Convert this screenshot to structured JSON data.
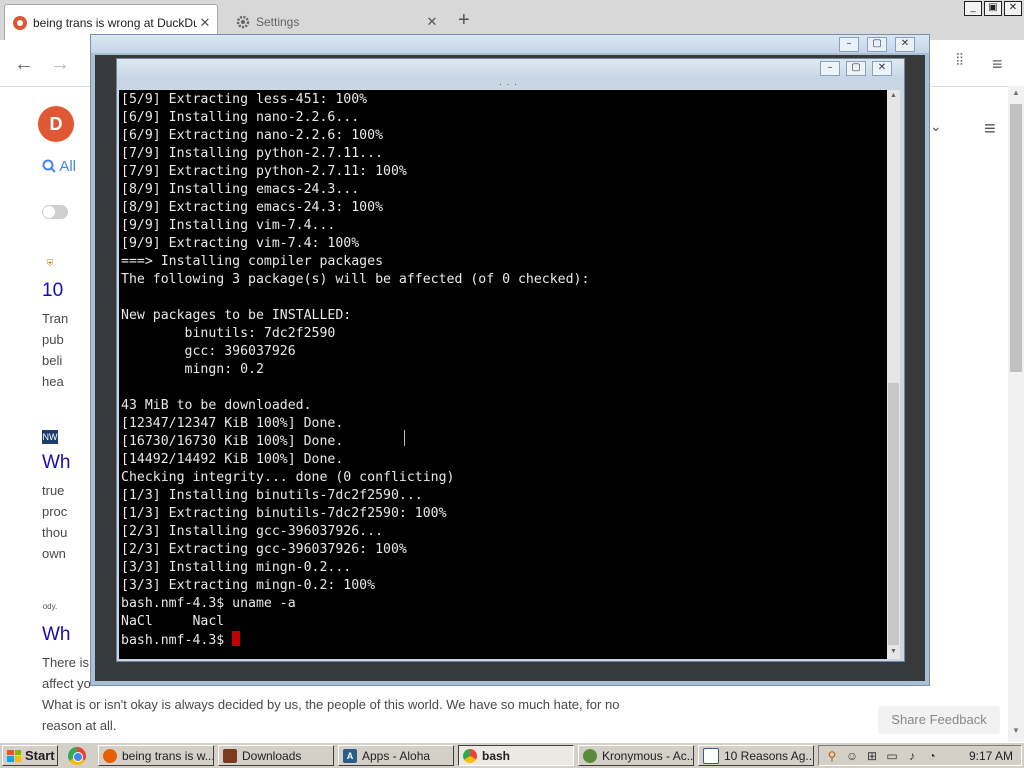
{
  "browser": {
    "tabs": [
      {
        "title": "being trans is wrong at DuckDuckGo",
        "active": true
      },
      {
        "title": "Settings",
        "active": false
      }
    ]
  },
  "page": {
    "search_tab": "All",
    "results": [
      {
        "title": "10",
        "snippet": [
          "Tran",
          "pub",
          "beli",
          "hea"
        ]
      },
      {
        "title": "Wh",
        "snippet": [
          "true",
          "proc",
          "thou",
          "own"
        ]
      },
      {
        "title": "Wh",
        "source": "ody."
      }
    ],
    "bottom_text": [
      "There is",
      "affect yo",
      "What is or isn't okay is always decided by us, the people of this world. We have so much hate, for no",
      "reason at all."
    ],
    "share_feedback": "Share Feedback"
  },
  "terminal": {
    "lines": [
      "[5/9] Extracting less-451: 100%",
      "[6/9] Installing nano-2.2.6...",
      "[6/9] Extracting nano-2.2.6: 100%",
      "[7/9] Installing python-2.7.11...",
      "[7/9] Extracting python-2.7.11: 100%",
      "[8/9] Installing emacs-24.3...",
      "[8/9] Extracting emacs-24.3: 100%",
      "[9/9] Installing vim-7.4...",
      "[9/9] Extracting vim-7.4: 100%",
      "===> Installing compiler packages",
      "The following 3 package(s) will be affected (of 0 checked):",
      "",
      "New packages to be INSTALLED:",
      "        binutils: 7dc2f2590",
      "        gcc: 396037926",
      "        mingn: 0.2",
      "",
      "43 MiB to be downloaded.",
      "[12347/12347 KiB 100%] Done.",
      "[16730/16730 KiB 100%] Done.",
      "[14492/14492 KiB 100%] Done.",
      "Checking integrity... done (0 conflicting)",
      "[1/3] Installing binutils-7dc2f2590...",
      "[1/3] Extracting binutils-7dc2f2590: 100%",
      "[2/3] Installing gcc-396037926...",
      "[2/3] Extracting gcc-396037926: 100%",
      "[3/3] Installing mingn-0.2...",
      "[3/3] Extracting mingn-0.2: 100%",
      "bash.nmf-4.3$ uname -a",
      "NaCl     Nacl"
    ],
    "prompt": "bash.nmf-4.3$ "
  },
  "taskbar": {
    "start": "Start",
    "tasks": [
      {
        "label": "being trans is w...",
        "icon": "firefox-icon",
        "color": "#e66000"
      },
      {
        "label": "Downloads",
        "icon": "downloads-icon",
        "color": "#7a3b1f"
      },
      {
        "label": "Apps - Aloha",
        "icon": "aloha-icon",
        "color": "#2a5d8a"
      },
      {
        "label": "bash",
        "icon": "chrome-icon",
        "color": "#4285f4",
        "active": true
      },
      {
        "label": "Kronymous - Ac...",
        "icon": "kronymous-icon",
        "color": "#5a8a3a"
      },
      {
        "label": "10 Reasons Ag...",
        "icon": "window-icon",
        "color": "#3a5a8a"
      }
    ],
    "clock": "9:17 AM"
  }
}
